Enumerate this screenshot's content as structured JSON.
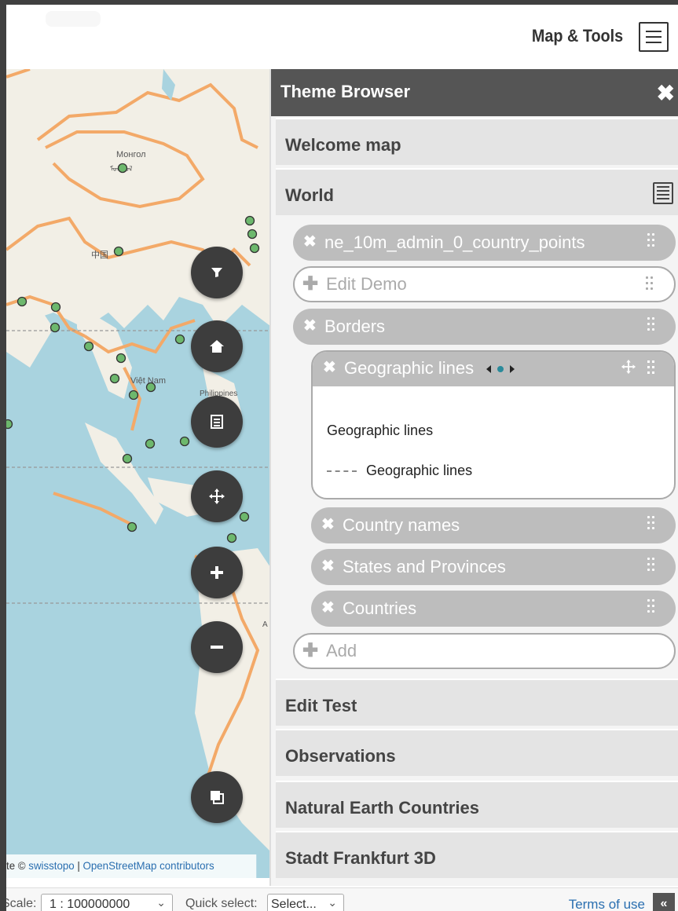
{
  "header": {
    "title": "Map & Tools"
  },
  "map": {
    "labels": [
      "Монгол",
      "ᠮᠣᠩᠭᠣᠯ",
      "中国",
      "Việt Nam",
      "Philippines",
      "A"
    ],
    "attribution": {
      "prefix": "te © ",
      "link1": "swisstopo",
      "sep": " | ",
      "link2": "OpenStreetMap contributors"
    },
    "point_color": "#6db86d",
    "border_color": "#f3a968",
    "water_color": "#a9d3df",
    "land_color": "#f2efe6"
  },
  "fabs": [
    "filter-icon",
    "home-icon",
    "list-icon",
    "move-icon",
    "plus-icon",
    "minus-icon",
    "layers-icon"
  ],
  "panel": {
    "title": "Theme Browser",
    "sections": [
      "Welcome map",
      "World",
      "Edit Test",
      "Observations",
      "Natural Earth Countries",
      "Stadt Frankfurt 3D"
    ],
    "layers": {
      "ne": "ne_10m_admin_0_country_points",
      "edit_demo": "Edit Demo",
      "borders": "Borders",
      "geo": "Geographic lines",
      "legend_title": "Geographic lines",
      "legend_item": "Geographic lines",
      "country_names": "Country names",
      "states": "States and Provinces",
      "countries": "Countries",
      "add": "Add"
    }
  },
  "footer": {
    "scale_label": "Scale:",
    "scale_value": "1 : 100000000",
    "quick_label": "Quick select:",
    "quick_value": "Select...",
    "terms": "Terms of use",
    "collapse": "«"
  }
}
